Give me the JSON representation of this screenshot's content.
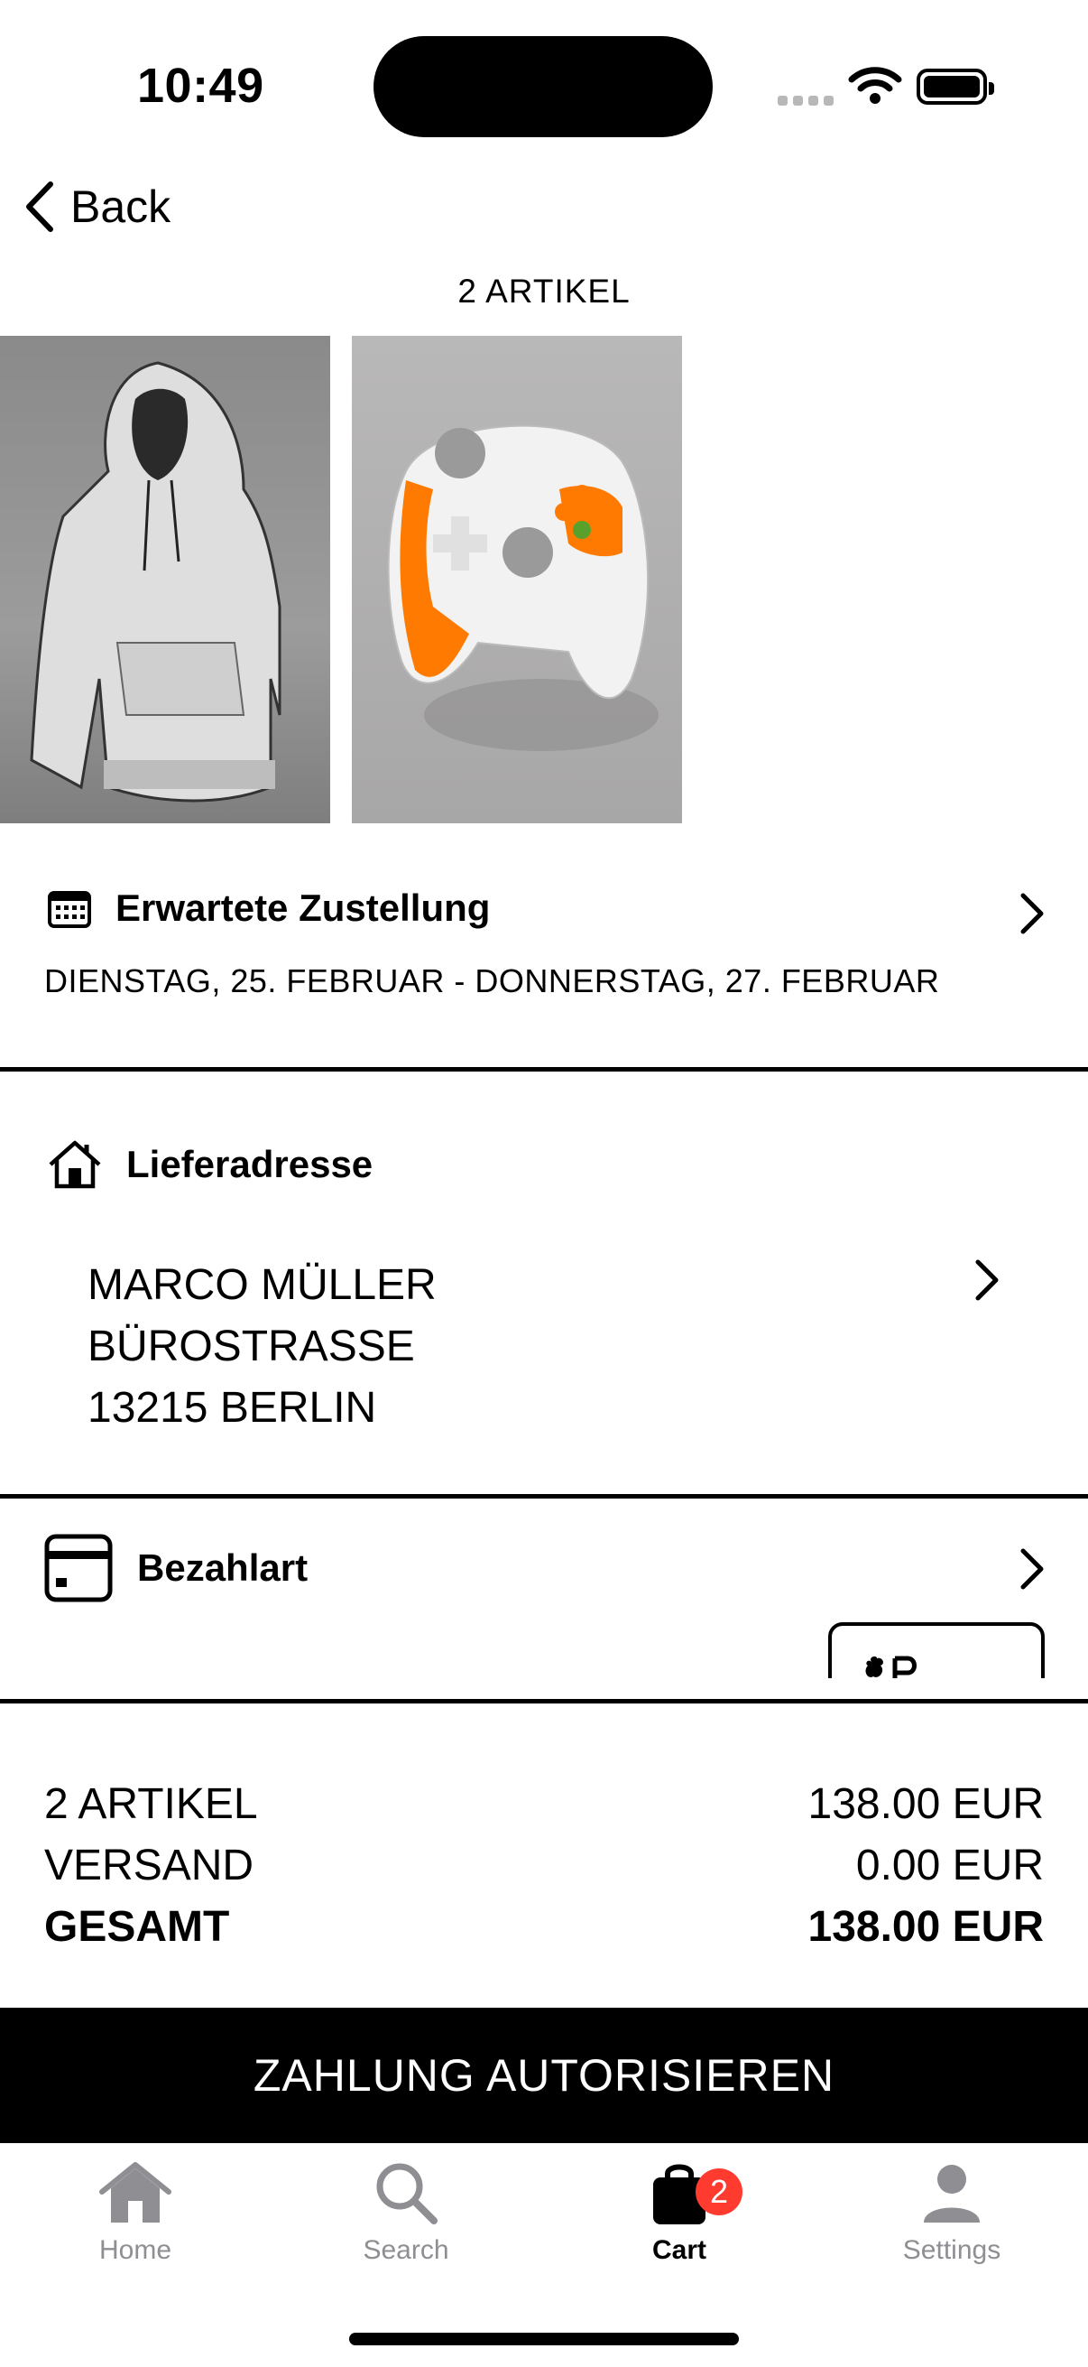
{
  "status_bar": {
    "time": "10:49"
  },
  "nav": {
    "back_label": "Back"
  },
  "order": {
    "items_count_label": "2 ARTIKEL"
  },
  "products": [
    {
      "name": "hoodie",
      "icon": "hoodie-image"
    },
    {
      "name": "game-controller",
      "icon": "controller-image"
    }
  ],
  "delivery": {
    "title": "Erwartete Zustellung",
    "dates": "DIENSTAG, 25. FEBRUAR - DONNERSTAG, 27. FEBRUAR"
  },
  "address": {
    "title": "Lieferadresse",
    "line1": "MARCO MÜLLER",
    "line2": "BÜROSTRASSE",
    "line3": "13215 BERLIN"
  },
  "payment": {
    "title": "Bezahlart",
    "method_icon": "apple-pay-logo"
  },
  "summary": {
    "items_label": "2 ARTIKEL",
    "items_value": "138.00 EUR",
    "shipping_label": "VERSAND",
    "shipping_value": "0.00 EUR",
    "total_label": "GESAMT",
    "total_value": "138.00 EUR"
  },
  "cta": {
    "label": "ZAHLUNG AUTORISIEREN"
  },
  "tabbar": {
    "tabs": [
      {
        "label": "Home",
        "icon": "house-icon",
        "active": false
      },
      {
        "label": "Search",
        "icon": "magnifier-icon",
        "active": false
      },
      {
        "label": "Cart",
        "icon": "bag-icon",
        "active": true,
        "badge": "2"
      },
      {
        "label": "Settings",
        "icon": "person-icon",
        "active": false
      }
    ]
  },
  "colors": {
    "badge": "#ff3b30",
    "inactive_tab": "#8e8e93",
    "controller_accent": "#ff7a00"
  }
}
